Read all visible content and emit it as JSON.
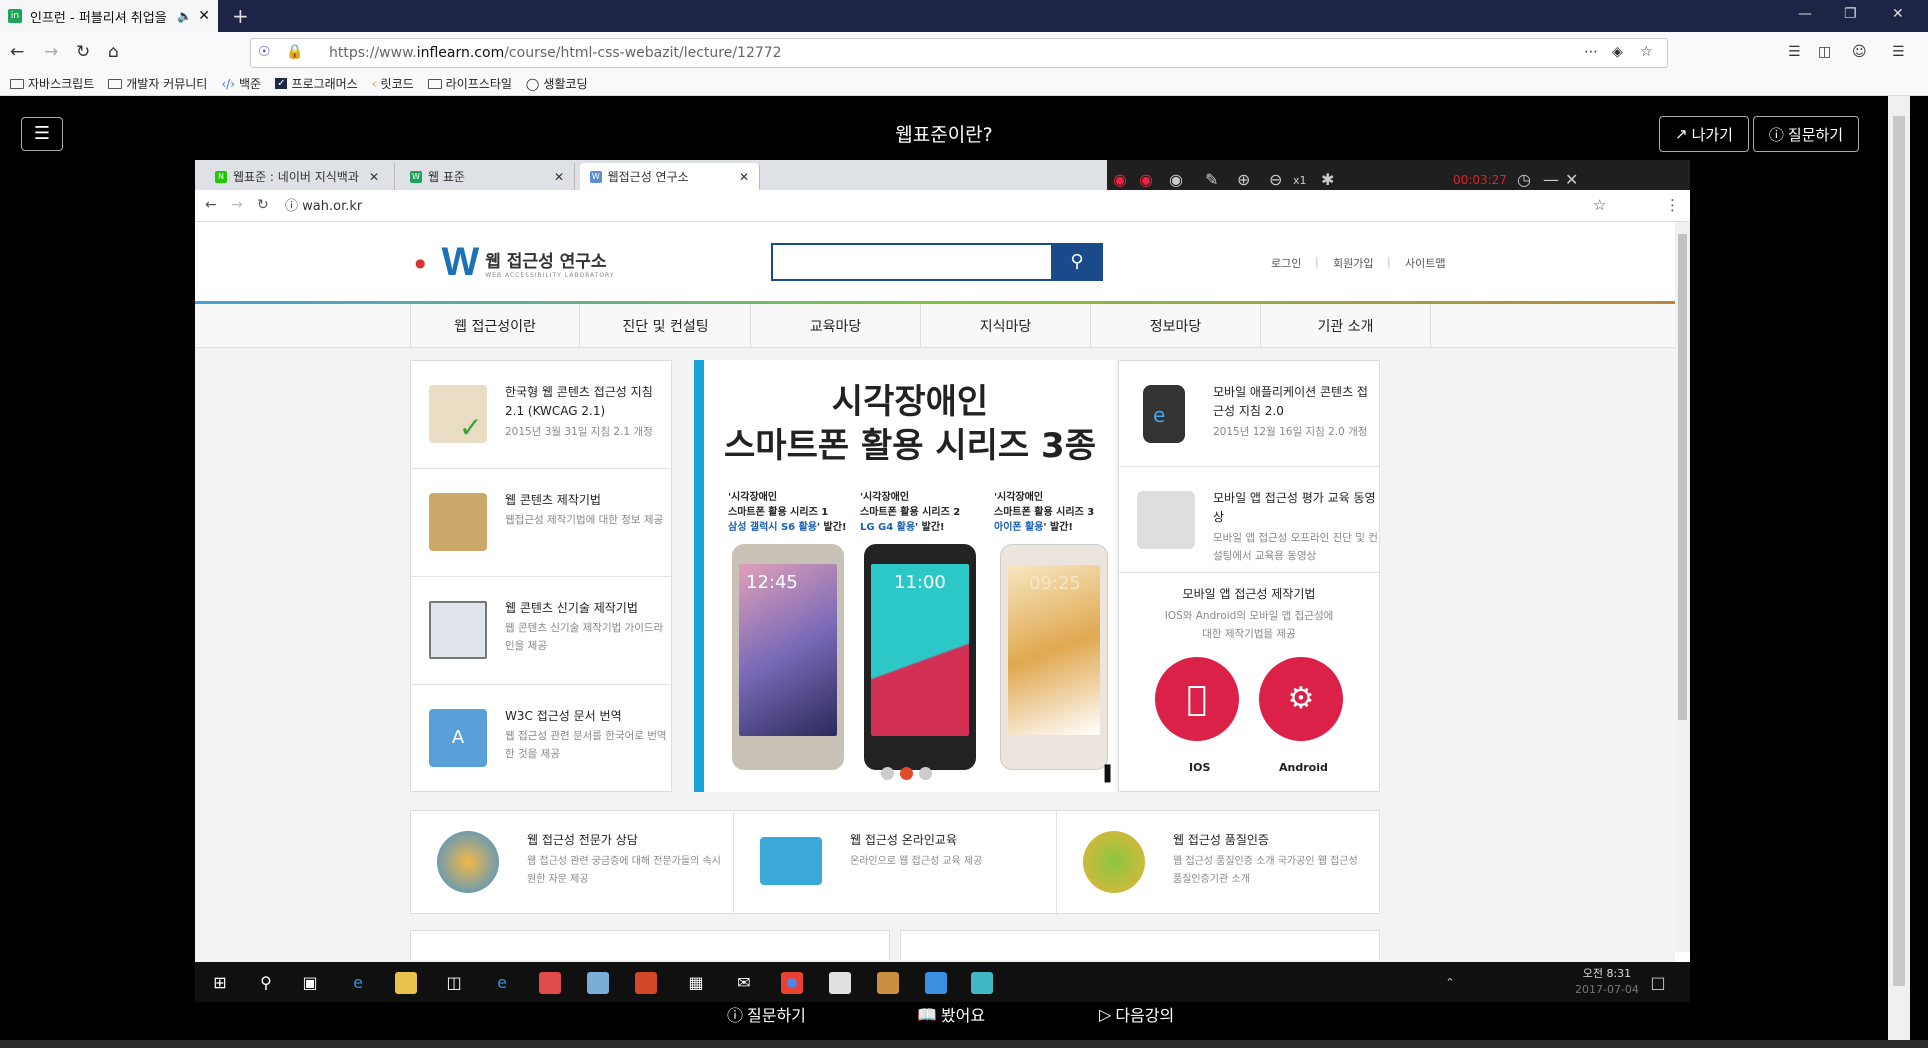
{
  "browser": {
    "tab_title": "인프런 - 퍼블리셔 취업을",
    "tab_fav": "in",
    "sound_icon": "speaker-icon",
    "url_prefix": "https://www.",
    "url_domain": "inflearn.com",
    "url_path": "/course/html-css-webazit/lecture/12772",
    "bookmarks": [
      "자바스크립트",
      "개발자 커뮤니티",
      "백준",
      "프로그래머스",
      "릿코드",
      "라이프스타일",
      "생활코딩"
    ]
  },
  "player": {
    "title": "웹표준이란?",
    "exit_label": "나가기",
    "question_label": "질문하기",
    "footer_question": "질문하기",
    "footer_seen": "봤어요",
    "footer_next": "다음강의"
  },
  "video": {
    "tabs": [
      "웹표준 : 네이버 지식백과",
      "웹 표준",
      "웹접근성 연구소"
    ],
    "tab_favs": [
      "N",
      "W",
      "W"
    ],
    "rec_time": "00:03:27",
    "rec_zoom": "x1",
    "url": "wah.or.kr",
    "site": {
      "logo_mark": "W",
      "logo_name": "웹 접근성 연구소",
      "logo_sub": "WEB ACCESSIBILITY LABORATORY",
      "util": [
        "로그인",
        "회원가입",
        "사이트맵"
      ],
      "gnb": [
        "웹 접근성이란",
        "진단 및 컨설팅",
        "교육마당",
        "지식마당",
        "정보마당",
        "기관 소개"
      ],
      "left_items": [
        {
          "title": "한국형 웹 콘텐츠 접근성 지침 2.1 (KWCAG 2.1)",
          "desc": "2015년 3월 31일 지침 2.1 개정"
        },
        {
          "title": "웹 콘텐츠 제작기법",
          "desc": "웹접근성 제작기법에 대한 정보 제공"
        },
        {
          "title": "웹 콘텐츠 신기술 제작기법",
          "desc": "웹 콘텐츠 신기술 제작기법 가이드라인을 제공"
        },
        {
          "title": "W3C 접근성 문서 번역",
          "desc": "웹 접근성 관련 문서를 한국어로 번역한 것을 제공"
        }
      ],
      "banner": {
        "line1": "시각장애인",
        "line2": "스마트폰 활용 시리즈 3종",
        "captions": [
          {
            "q": "'시각장애인",
            "l2": "스마트폰 활용 시리즈 1",
            "hl": "삼성 갤럭시 S6 활용",
            "tail": "' 발간!"
          },
          {
            "q": "'시각장애인",
            "l2": "스마트폰 활용 시리즈 2",
            "hl": "LG G4 활용",
            "tail": "' 발간!"
          },
          {
            "q": "'시각장애인",
            "l2": "스마트폰 활용 시리즈 3",
            "hl": "아이폰 활용",
            "tail": "' 발간!"
          }
        ],
        "clocks": [
          "12:45",
          "11:00",
          "09:25"
        ]
      },
      "right_items": [
        {
          "title": "모바일 애플리케이션 콘텐츠 접근성 지침 2.0",
          "desc": "2015년 12월 16일 지침 2.0 개정"
        },
        {
          "title": "모바일 앱 접근성 평가 교육 동영상",
          "desc": "모바일 앱 접근성 오프라인 진단 및 컨설팅에서 교육용 동영상"
        }
      ],
      "mobile_box": {
        "title": "모바일 앱 접근성 제작기법",
        "desc": "IOS와 Android의 모바일 앱 접근성에 대한 제작기법을 제공",
        "ios": "IOS",
        "android": "Android"
      },
      "bottom_items": [
        {
          "title": "웹 접근성 전문가 상담",
          "desc": "웹 접근성 관련 궁금증에 대해 전문가들의 속시원한 자문 제공"
        },
        {
          "title": "웹 접근성 온라인교육",
          "desc": "온라인으로 웹 접근성 교육 제공"
        },
        {
          "title": "웹 접근성 품질인증",
          "desc": "웹 접근성 품질인증 소개 국가공인 웹 접근성 품질인증기관 소개"
        }
      ]
    },
    "taskbar": {
      "time": "오전 8:31",
      "date": "2017-07-04"
    }
  },
  "colors": {
    "accent_blue": "#1a4a8a",
    "app_red": "#dc2148",
    "banner_stripe": "#1aa3d9"
  }
}
